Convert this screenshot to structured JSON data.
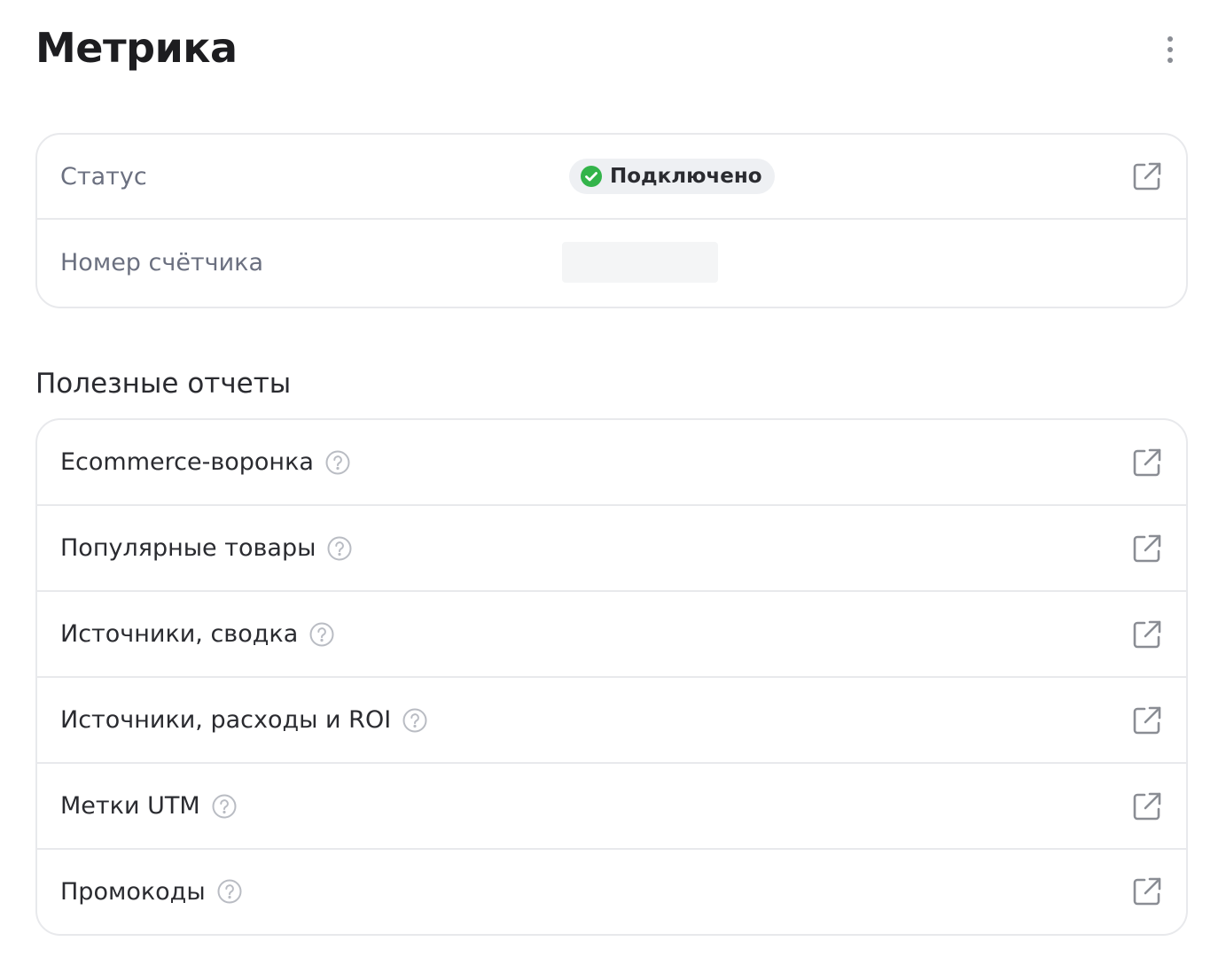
{
  "header": {
    "title": "Метрика",
    "menu_icon": "kebab-menu-icon"
  },
  "info": {
    "status_label": "Статус",
    "status_value": "Подключено",
    "status_color": "#33b44a",
    "counter_label": "Номер счётчика",
    "counter_value": ""
  },
  "reports": {
    "title": "Полезные отчеты",
    "items": [
      {
        "label": "Ecommerce-воронка"
      },
      {
        "label": "Популярные товары"
      },
      {
        "label": "Источники, сводка"
      },
      {
        "label": "Источники, расходы и ROI"
      },
      {
        "label": "Метки UTM"
      },
      {
        "label": "Промокоды"
      }
    ]
  },
  "icons": {
    "external": "external-link-icon",
    "help": "help-circle-icon",
    "status": "check-circle-icon"
  },
  "colors": {
    "text": "#1d1d20",
    "muted": "#6b7080",
    "border": "#e8e9ec",
    "icon": "#8a8d94"
  }
}
